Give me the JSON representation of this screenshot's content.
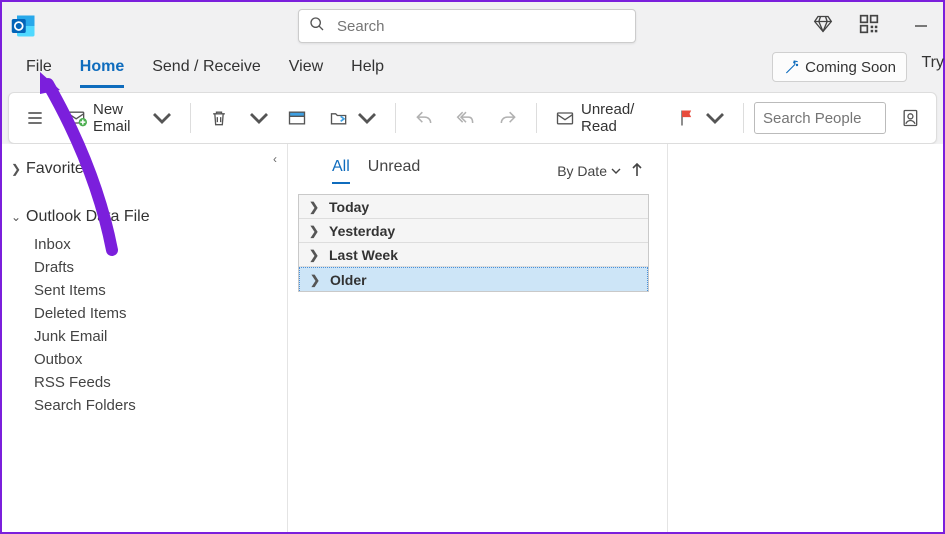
{
  "search": {
    "placeholder": "Search"
  },
  "menu": {
    "items": [
      "File",
      "Home",
      "Send / Receive",
      "View",
      "Help"
    ],
    "activeIndex": 1,
    "coming_soon": "Coming Soon",
    "try": "Try"
  },
  "ribbon": {
    "new_email": "New Email",
    "unread_read": "Unread/ Read",
    "search_people_placeholder": "Search People"
  },
  "sidebar": {
    "favorites": "Favorites",
    "data_file": "Outlook Data File",
    "folders": [
      "Inbox",
      "Drafts",
      "Sent Items",
      "Deleted Items",
      "Junk Email",
      "Outbox",
      "RSS Feeds",
      "Search Folders"
    ]
  },
  "maillist": {
    "tabs": {
      "all": "All",
      "unread": "Unread"
    },
    "sort_label": "By Date",
    "groups": [
      "Today",
      "Yesterday",
      "Last Week",
      "Older"
    ],
    "selectedGroupIndex": 3
  }
}
